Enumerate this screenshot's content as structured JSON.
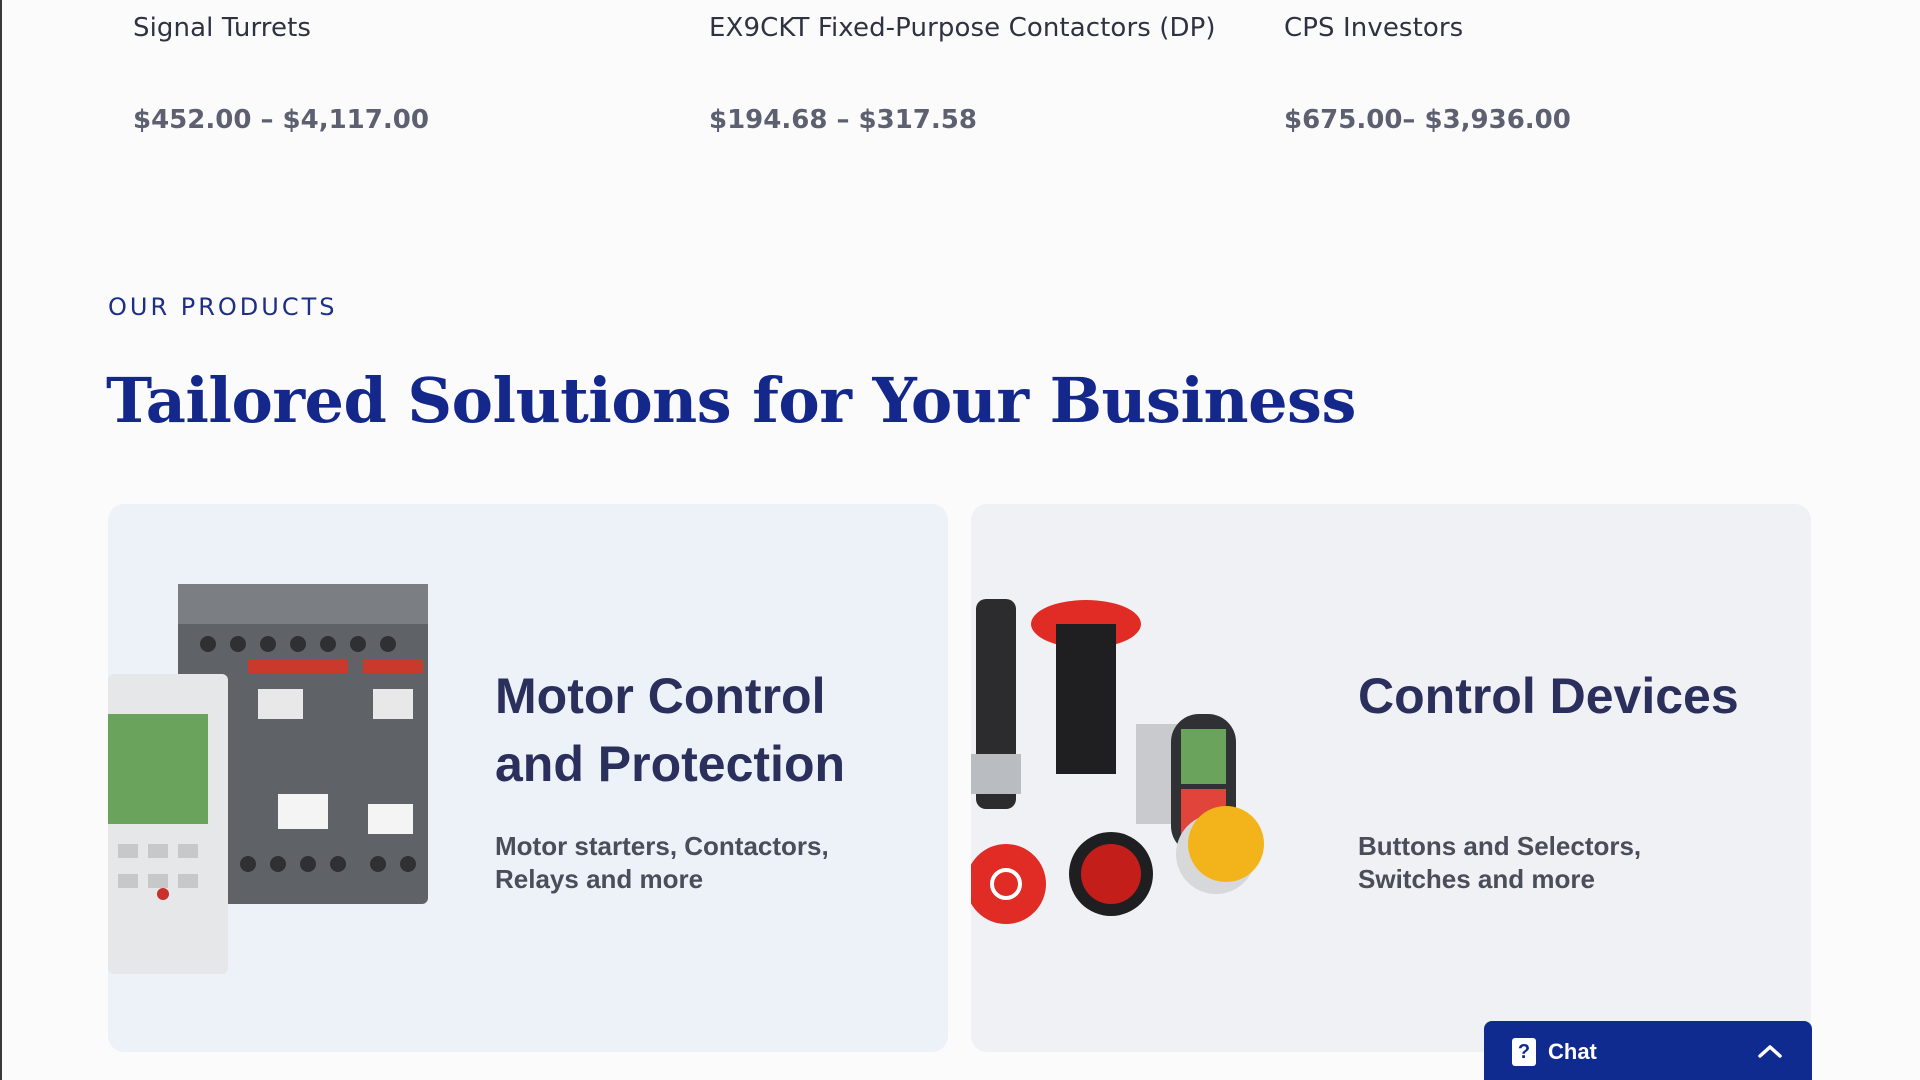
{
  "products": [
    {
      "name": "Signal Turrets",
      "price": "$452.00 – $4,117.00"
    },
    {
      "name": "EX9CKT Fixed-Purpose Contactors (DP)",
      "price": "$194.68 – $317.58"
    },
    {
      "name": "CPS Investors",
      "price": "$675.00– $3,936.00"
    }
  ],
  "section": {
    "eyebrow": "OUR PRODUCTS",
    "headline": "Tailored Solutions for Your Business"
  },
  "cards": [
    {
      "title": "Motor Control and Protection",
      "description": "Motor starters, Contactors, Relays and more",
      "image_icon": "motor-control-devices-image"
    },
    {
      "title": "Control Devices",
      "description": "Buttons and Selectors, Switches  and more",
      "image_icon": "push-buttons-image"
    }
  ],
  "chat": {
    "label": "Chat",
    "icon": "question-icon",
    "toggle_icon": "chevron-up-icon"
  },
  "colors": {
    "brand_navy": "#14288c",
    "chat_bg": "#0f2b8f",
    "card_a_bg": "#edf2f8",
    "card_b_bg": "#f0f1f4"
  }
}
